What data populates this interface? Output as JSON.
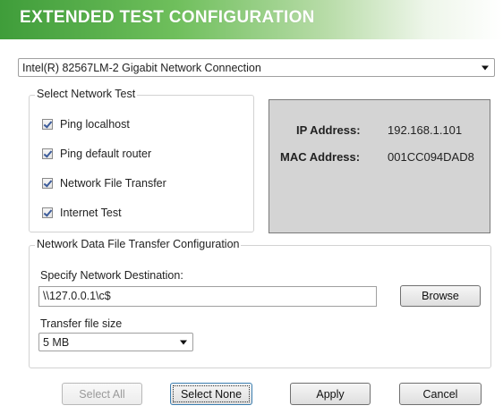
{
  "header": {
    "title": "EXTENDED TEST CONFIGURATION"
  },
  "adapter": {
    "selected": "Intel(R) 82567LM-2 Gigabit Network Connection"
  },
  "network_test": {
    "group_label": "Select Network Test",
    "options": [
      {
        "label": "Ping localhost",
        "checked": true
      },
      {
        "label": "Ping default router",
        "checked": true
      },
      {
        "label": "Network File Transfer",
        "checked": true
      },
      {
        "label": "Internet Test",
        "checked": true
      }
    ]
  },
  "info": {
    "ip_label": "IP Address:",
    "ip_value": "192.168.1.101",
    "mac_label": "MAC Address:",
    "mac_value": "001CC094DAD8"
  },
  "transfer": {
    "group_label": "Network Data File Transfer Configuration",
    "dest_label": "Specify Network Destination:",
    "dest_value": "\\\\127.0.0.1\\c$",
    "browse_label": "Browse",
    "size_label": "Transfer file size",
    "size_value": "5 MB"
  },
  "buttons": {
    "select_all": "Select All",
    "select_none": "Select None",
    "apply": "Apply",
    "cancel": "Cancel"
  },
  "colors": {
    "header_green": "#3f9d3a",
    "info_panel_bg": "#d4d4d4"
  }
}
